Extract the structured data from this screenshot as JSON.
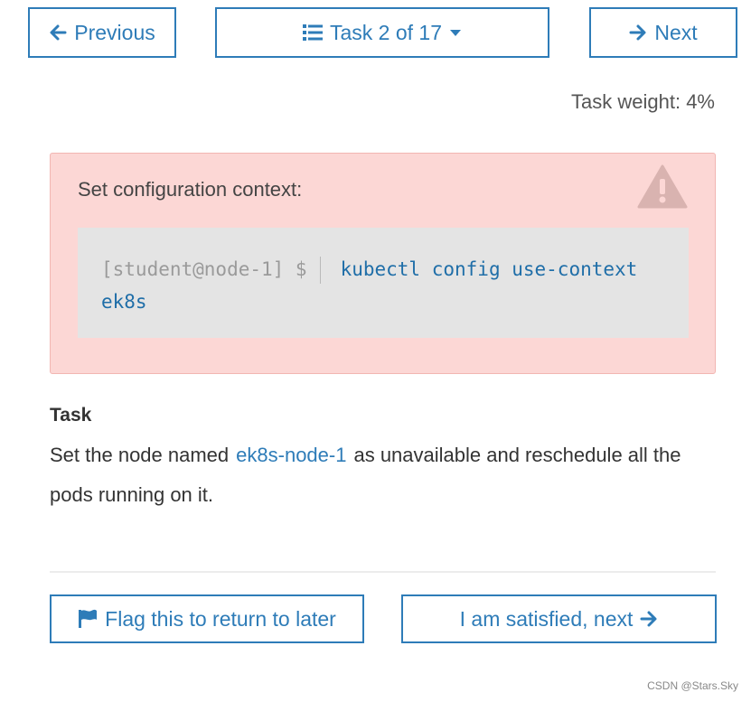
{
  "nav": {
    "previous_label": "Previous",
    "task_label": "Task 2 of 17",
    "next_label": "Next"
  },
  "task_weight": "Task weight: 4%",
  "context": {
    "title": "Set configuration context:",
    "prompt": "[student@node-1] $",
    "command_line1": "kubectl config use-context",
    "command_line2": "ek8s"
  },
  "task": {
    "heading": "Task",
    "text_before": "Set the node named",
    "node_name": "ek8s-node-1",
    "text_after": "as unavailable and reschedule all the pods running on it."
  },
  "actions": {
    "flag_label": "Flag this to return to later",
    "satisfied_label": "I am satisfied, next"
  },
  "watermark": "CSDN @Stars.Sky",
  "colors": {
    "accent": "#2e7cb8",
    "alert_bg": "#fcd7d5",
    "code_bg": "#e4e4e4"
  },
  "icons": [
    "arrow-left-icon",
    "list-icon",
    "caret-down-icon",
    "arrow-right-icon",
    "warning-icon",
    "flag-icon"
  ]
}
